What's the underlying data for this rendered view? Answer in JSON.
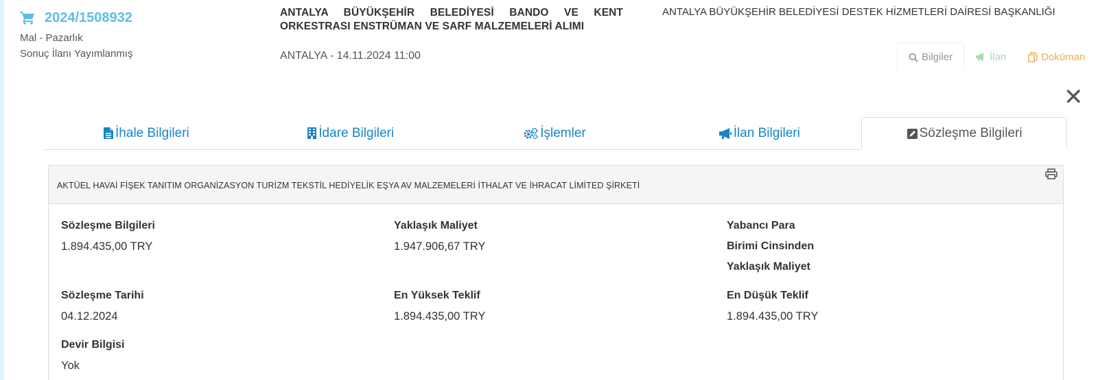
{
  "header": {
    "tender_number": "2024/1508932",
    "tender_type": "Mal - Pazarlık",
    "status": "Sonuç İlanı Yayımlanmış",
    "title_line1": "ANTALYA BÜYÜKŞEHİR BELEDİYESİ BANDO VE KENT",
    "title_line2": "ORKESTRASI ENSTRÜMAN VE SARF MALZEMELERİ ALIMI",
    "place_date": "ANTALYA - 14.11.2024 11:00",
    "department": "ANTALYA BÜYÜKŞEHİR BELEDİYESİ DESTEK HİZMETLERİ DAİRESİ BAŞKANLIĞI",
    "tabs": [
      {
        "label": "Bilgiler",
        "icon": "search-icon"
      },
      {
        "label": "İlan",
        "icon": "megaphone-icon"
      },
      {
        "label": "Doküman",
        "icon": "copy-icon"
      }
    ]
  },
  "main_tabs": [
    {
      "label": "İhale Bilgileri",
      "icon": "file-icon"
    },
    {
      "label": "İdare Bilgileri",
      "icon": "building-icon"
    },
    {
      "label": "İşlemler",
      "icon": "gears-icon"
    },
    {
      "label": "İlan Bilgileri",
      "icon": "megaphone-icon"
    },
    {
      "label": "Sözleşme Bilgileri",
      "icon": "edit-icon"
    }
  ],
  "panel": {
    "company": "AKTÜEL HAVAİ FİŞEK TANITIM ORGANİZASYON TURİZM TEKSTİL HEDİYELİK EŞYA AV MALZEMELERİ İTHALAT VE İHRACAT LİMİTED ŞİRKETİ",
    "fields": {
      "contract_label": "Sözleşme Bilgileri",
      "contract_value": "1.894.435,00 TRY",
      "approx_cost_label": "Yaklaşık Maliyet",
      "approx_cost_value": "1.947.906,67 TRY",
      "foreign_label_1": "Yabancı Para",
      "foreign_label_2": "Birimi Cinsinden",
      "foreign_label_3": "Yaklaşık Maliyet",
      "contract_date_label": "Sözleşme Tarihi",
      "contract_date_value": "04.12.2024",
      "highest_bid_label": "En Yüksek Teklif",
      "highest_bid_value": "1.894.435,00 TRY",
      "lowest_bid_label": "En Düşük Teklif",
      "lowest_bid_value": "1.894.435,00 TRY",
      "transfer_label": "Devir Bilgisi",
      "transfer_value": "Yok"
    }
  },
  "colors": {
    "accent_blue": "#1a83c6",
    "cart_blue": "#5bc0de",
    "ilan_green": "#a6dcb0",
    "doc_orange": "#f0ad4e"
  }
}
